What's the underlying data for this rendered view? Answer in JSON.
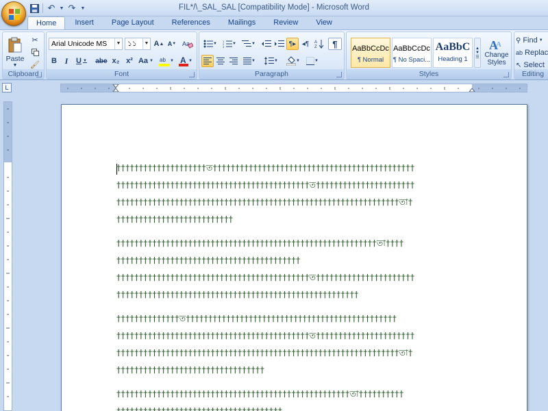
{
  "title": "FIL*/\\_SAL_SAL [Compatibility Mode] - Microsoft Word",
  "tabs": [
    "Home",
    "Insert",
    "Page Layout",
    "References",
    "Mailings",
    "Review",
    "View"
  ],
  "clipboard": {
    "label": "Clipboard",
    "paste": "Paste"
  },
  "font": {
    "label": "Font",
    "name": "Arial Unicode MS",
    "size": "১১",
    "bold": "B",
    "italic": "I",
    "underline": "U",
    "strike": "abe",
    "sub": "x₂",
    "sup": "x²",
    "case": "Aa",
    "grow": "A",
    "shrink": "A"
  },
  "paragraph": {
    "label": "Paragraph",
    "pilcrow": "¶"
  },
  "styles": {
    "label": "Styles",
    "items": [
      {
        "sample": "AaBbCcDc",
        "name": "¶ Normal"
      },
      {
        "sample": "AaBbCcDc",
        "name": "¶ No Spaci..."
      },
      {
        "sample": "AaBbC",
        "name": "Heading 1"
      }
    ],
    "change": "Change Styles"
  },
  "editing": {
    "label": "Editing",
    "find": "Find",
    "replace": "Replace",
    "select": "Select"
  },
  "ruler_box": "L",
  "document": {
    "paragraphs": [
      [
        "††††††††††††††††††††ত†††††††††††††††††††††††††††††††††††††††††††††",
        "†††††††††††††††††††††††††††††††††††††††††††ত††††††††††††††††††††††",
        "†††††††††††††††††††††††††††††††††††††††††††††††††††††††††††††††তা†",
        "††††††††††††††††††††††††††"
      ],
      [
        "††††††††††††††††††††††††††††††††††††††††††††††††††††††††††তা††††",
        "†††††††††††††††††††††††††††††††††††††††††",
        "†††††††††††††††††††††††††††††††††††††††††††ত††††††††††††††††††††††",
        "††††††††††††††††††††††††††††††††††††††††††††††††††††††"
      ],
      [
        "††††††††††††††ত†††††††††††††††††††††††††††††††††††††††††††††††",
        "†††††††††††††††††††††††††††††††††††††††††††ত††††††††††††††††††††††",
        "†††††††††††††††††††††††††††††††††††††††††††††††††††††††††††††††তা†",
        "†††††††††††††††††††††††††††††††††"
      ],
      [
        "††††††††††††††††††††††††††††††††††††††††††††††††††††তা††††††††††",
        "†††††††††††††††††††††††††††††††††††††"
      ]
    ]
  }
}
